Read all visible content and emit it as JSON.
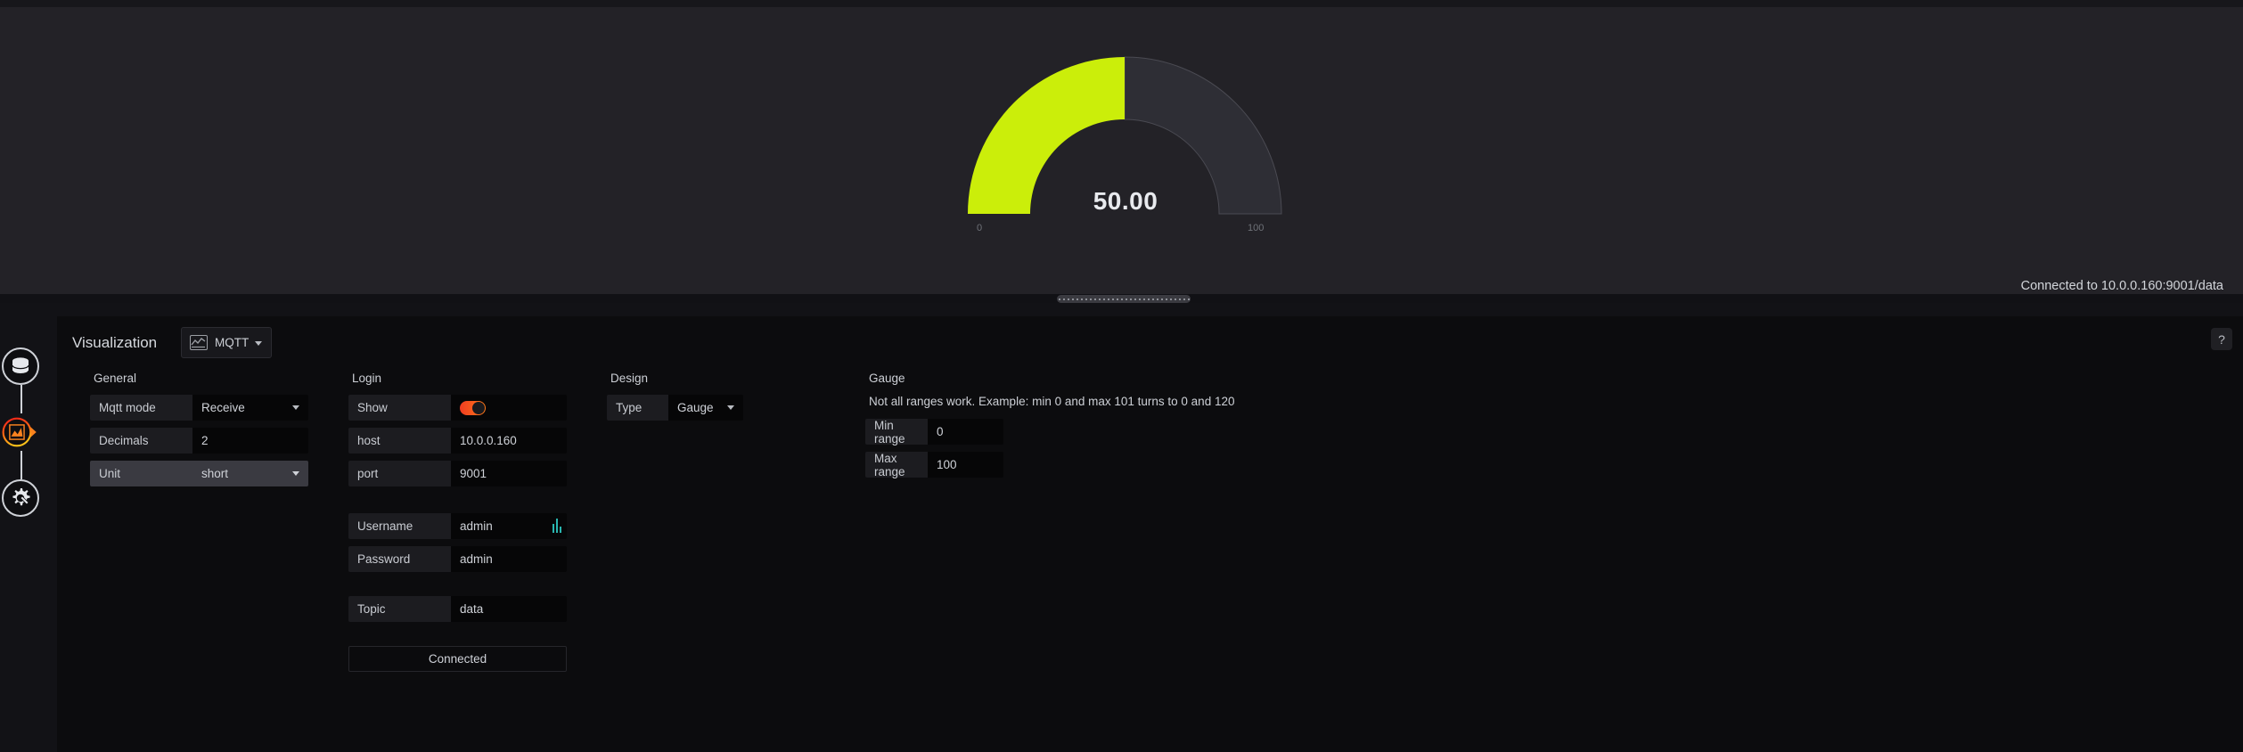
{
  "colors": {
    "gauge_value_fill": "#cbee0a",
    "gauge_track": "#32323a",
    "panel_bg": "#232227",
    "options_bg": "#0c0c0e",
    "toggle_on_start": "#f03c22",
    "toggle_on_end": "#ff7a18",
    "active_node_start": "#ef1a1a",
    "active_node_end": "#ffa217",
    "accent_teal": "#29b6b0"
  },
  "top": {
    "collapse_icon": "chevron-down-icon"
  },
  "gauge_panel": {
    "connection_status": "Connected to 10.0.0.160:9001/data",
    "resize_handle": "panel-resize-handle"
  },
  "chart_data": {
    "type": "gauge",
    "title": "",
    "value": 50,
    "value_label": "50.00",
    "min": 0,
    "max": 100,
    "min_label": "0",
    "max_label": "100",
    "unit": "short",
    "decimals": 2,
    "start_angle": -90,
    "end_angle": 90,
    "fill_color": "#cbee0a",
    "track_color": "#32323a",
    "percent_filled": 50
  },
  "options": {
    "visualization_label": "Visualization",
    "visualization_value": "MQTT",
    "visualization_icon": "graph-panel-icon",
    "help_label": "?",
    "general": {
      "title": "General",
      "rows": [
        {
          "key": "Mqtt mode",
          "value": "Receive",
          "kind": "select"
        },
        {
          "key": "Decimals",
          "value": "2",
          "kind": "input"
        },
        {
          "key": "Unit",
          "value": "short",
          "kind": "select"
        }
      ]
    },
    "login": {
      "title": "Login",
      "show_key": "Show",
      "show_value": "on",
      "host_key": "host",
      "host_value": "10.0.0.160",
      "port_key": "port",
      "port_value": "9001",
      "username_key": "Username",
      "username_value": "admin",
      "password_key": "Password",
      "password_value": "admin",
      "topic_key": "Topic",
      "topic_value": "data",
      "connect_button": "Connected"
    },
    "design": {
      "title": "Design",
      "type_key": "Type",
      "type_value": "Gauge"
    },
    "gauge": {
      "title": "Gauge",
      "help": "Not all ranges work. Example: min 0 and max 101 turns to 0 and 120",
      "min_key": "Min range",
      "min_value": "0",
      "max_key": "Max range",
      "max_value": "100"
    }
  },
  "rail": {
    "items": [
      {
        "name": "database-icon",
        "label": "Data source"
      },
      {
        "name": "area-chart-icon",
        "label": "Visualization"
      },
      {
        "name": "gear-wrench-icon",
        "label": "Settings"
      }
    ]
  }
}
